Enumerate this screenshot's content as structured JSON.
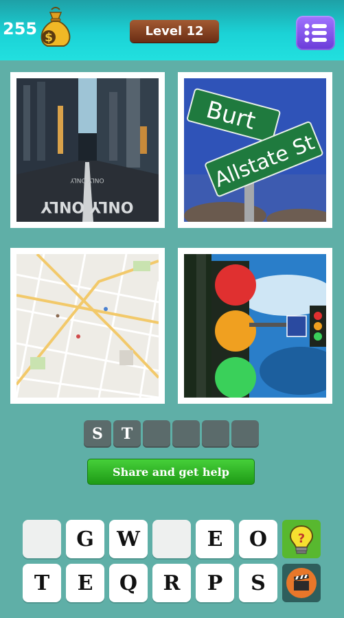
{
  "header": {
    "coins": "255",
    "level_label": "Level 12",
    "icons": {
      "coin_bag": "money-bag-icon",
      "menu": "list-menu-icon"
    },
    "colors": {
      "header_top": "#1ea0a6",
      "header_bottom": "#22e0df",
      "menu_button": "#7a4bea",
      "level_badge": "#8a4424"
    }
  },
  "pictures": [
    {
      "name": "city-street-photo"
    },
    {
      "name": "street-sign-photo",
      "sign_text_1": "Burt",
      "sign_text_2": "Allstate St"
    },
    {
      "name": "city-map-photo"
    },
    {
      "name": "traffic-light-photo"
    }
  ],
  "answer": {
    "slots": [
      "S",
      "T",
      "",
      "",
      "",
      ""
    ]
  },
  "share_button": {
    "label": "Share and get help"
  },
  "keyboard": {
    "row1": [
      "",
      "G",
      "W",
      "",
      "E",
      "O"
    ],
    "row2": [
      "T",
      "E",
      "Q",
      "R",
      "P",
      "S"
    ]
  },
  "side_buttons": {
    "hint": "lightbulb-hint-icon",
    "video": "clapperboard-video-icon",
    "colors": {
      "hint_bg": "#58b82f",
      "video_bg": "#2e5e5c"
    }
  }
}
